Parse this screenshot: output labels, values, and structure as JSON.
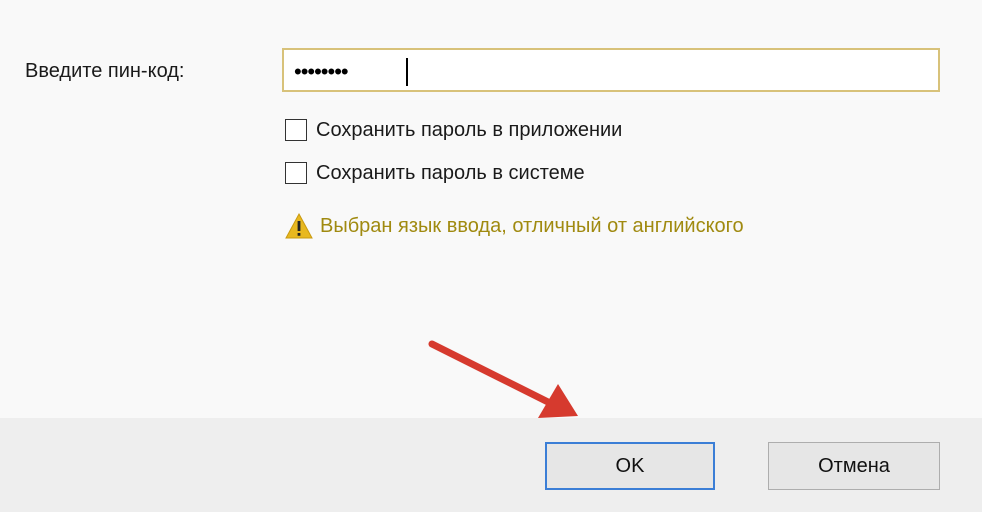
{
  "dialog": {
    "pin_label": "Введите пин-код:",
    "pin_value": "••••••••",
    "save_in_app_label": "Сохранить пароль в приложении",
    "save_in_system_label": "Сохранить пароль в системе",
    "save_in_app_checked": false,
    "save_in_system_checked": false,
    "warning_text": "Выбран язык ввода, отличный от английского",
    "warning_icon": "warning-triangle-icon",
    "ok_label": "OK",
    "cancel_label": "Отмена"
  },
  "colors": {
    "warning": "#a08a10",
    "focus_border": "#3b7ed6",
    "pin_border": "#d8c27a",
    "annotation_arrow": "#d63a2e"
  }
}
